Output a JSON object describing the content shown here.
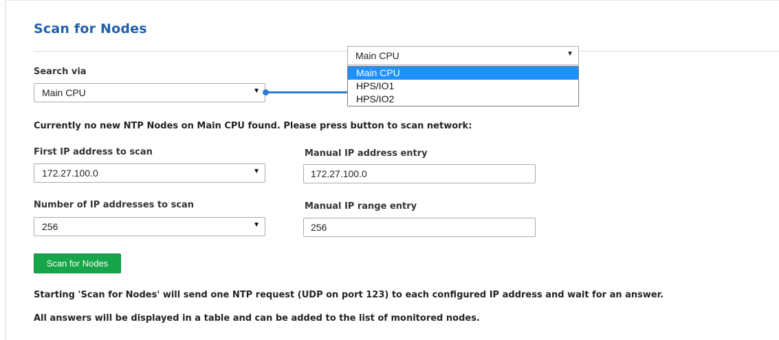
{
  "page": {
    "title": "Scan for Nodes"
  },
  "search_via": {
    "label": "Search via",
    "selected": "Main CPU"
  },
  "dropdown": {
    "selected": "Main CPU",
    "options": [
      "Main CPU",
      "HPS/IO1",
      "HPS/IO2"
    ]
  },
  "status_message": "Currently no new NTP Nodes on Main CPU found. Please press button to scan network:",
  "first_ip": {
    "label": "First IP address to scan",
    "selected": "172.27.100.0"
  },
  "manual_ip": {
    "label": "Manual IP address entry",
    "value": "172.27.100.0"
  },
  "ip_count": {
    "label": "Number of IP addresses to scan",
    "selected": "256"
  },
  "manual_range": {
    "label": "Manual IP range entry",
    "value": "256"
  },
  "scan_button": {
    "label": "Scan for Nodes"
  },
  "notes": {
    "line1": "Starting 'Scan for Nodes' will send one NTP request (UDP on port 123) to each configured IP address and wait for an answer.",
    "line2": "All answers will be displayed in a table and can be added to the list of monitored nodes."
  },
  "colors": {
    "title": "#1f5fa8",
    "button_bg": "#16a548",
    "highlight": "#1e90ff",
    "connector": "#2b7ccf"
  },
  "icons": {
    "select_arrow": "triangle-down"
  }
}
